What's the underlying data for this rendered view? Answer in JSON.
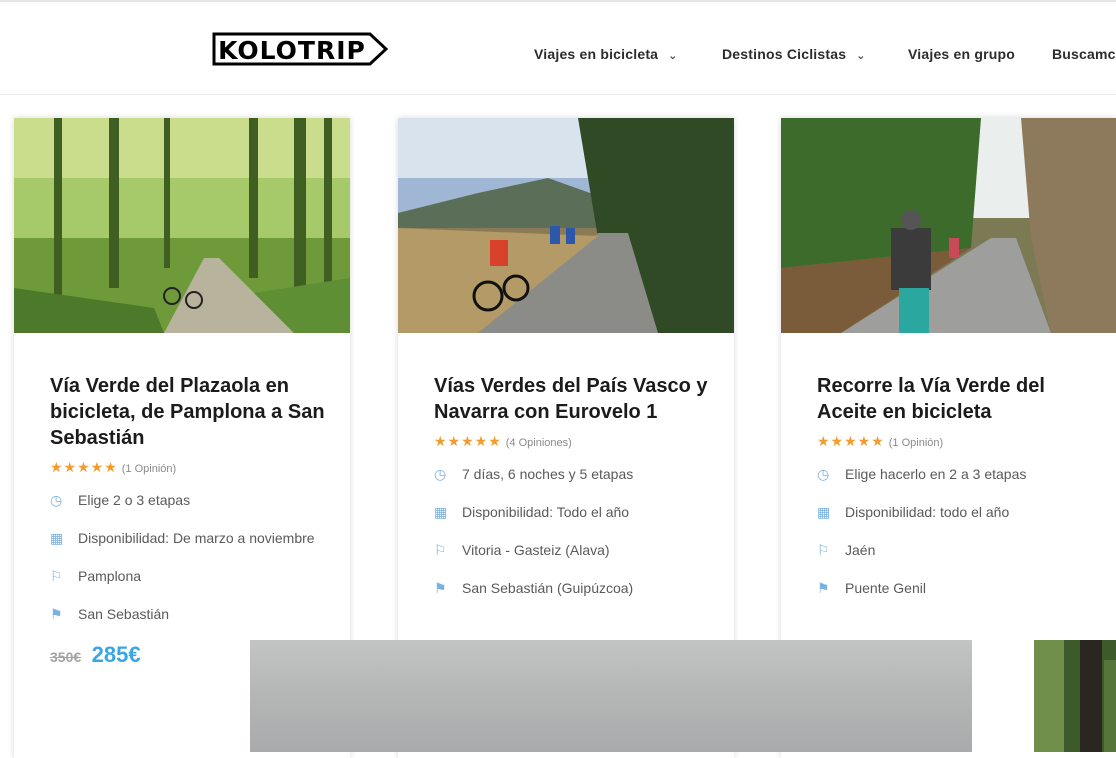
{
  "header": {
    "logo_text": "KOLOTRIP",
    "nav": [
      {
        "label": "Viajes en bicicleta",
        "dropdown": true
      },
      {
        "label": "Destinos Ciclistas",
        "dropdown": true
      },
      {
        "label": "Viajes en grupo",
        "dropdown": false
      },
      {
        "label": "Buscamc",
        "dropdown": false
      }
    ]
  },
  "colors": {
    "star": "#f39c2b",
    "accent_price": "#3ba6e6",
    "icon": "#79b1e0"
  },
  "cards": [
    {
      "title": "Vía Verde del Plazaola en bicicleta, de Pamplona a San Sebastián",
      "stars": "★★★★★",
      "reviews": "(1 Opinión)",
      "duration": "Elige 2 o 3 etapas",
      "availability": "Disponibilidad: De marzo a noviembre",
      "start": "Pamplona",
      "end": "San Sebastián",
      "old_price": "350€",
      "price": "285€"
    },
    {
      "title": "Vías Verdes del País Vasco y Navarra con Eurovelo 1",
      "stars": "★★★★★",
      "reviews": "(4 Opiniones)",
      "duration": "7 días, 6 noches y 5 etapas",
      "availability": "Disponibilidad: Todo el año",
      "start": "Vitoria - Gasteiz (Alava)",
      "end": "San Sebastián (Guipúzcoa)"
    },
    {
      "title": "Recorre la Vía Verde del Aceite en bicicleta",
      "stars": "★★★★★",
      "reviews": "(1 Opinión)",
      "duration": "Elige hacerlo en 2 a 3 etapas",
      "availability": "Disponibilidad: todo el año",
      "start": "Jaén",
      "end": "Puente Genil"
    }
  ]
}
